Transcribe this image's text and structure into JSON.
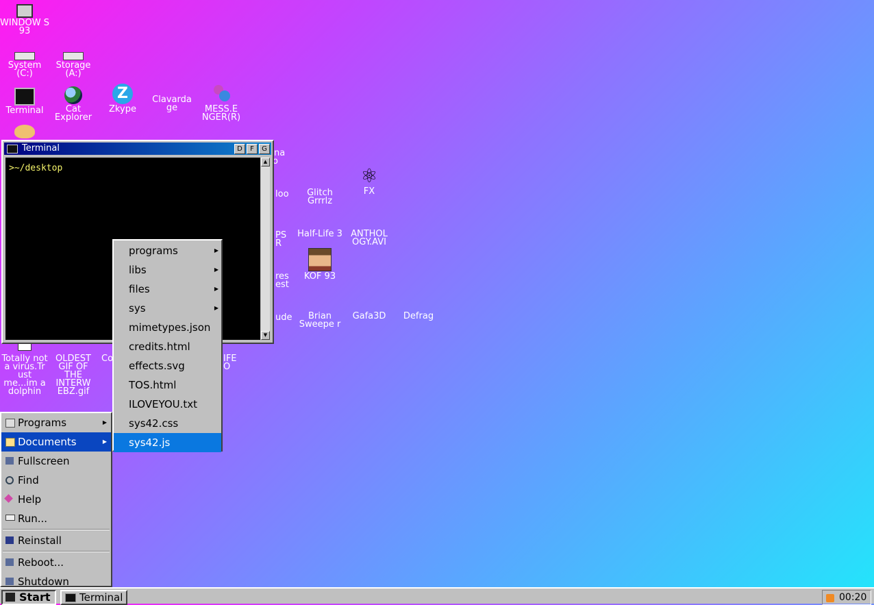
{
  "desktop": {
    "icons": [
      {
        "name": "windows93",
        "label": "WINDOW S 93",
        "glyph": "pc"
      },
      {
        "name": "system-c",
        "label": "System (C:)",
        "glyph": "drive"
      },
      {
        "name": "storage-a",
        "label": "Storage (A:)",
        "glyph": "drive"
      },
      {
        "name": "terminal",
        "label": "Terminal",
        "glyph": "terminal"
      },
      {
        "name": "cat-explorer",
        "label": "Cat Explorer",
        "glyph": "globe"
      },
      {
        "name": "zkype",
        "label": "Zkype",
        "glyph": "zk"
      },
      {
        "name": "clavardage",
        "label": "Clavarda ge",
        "glyph": "none"
      },
      {
        "name": "messenger",
        "label": "MESS.E NGER(R)",
        "glyph": "msn"
      },
      {
        "name": "glitch-grrrlz",
        "label": "Glitch Grrrlz",
        "glyph": "none"
      },
      {
        "name": "fx",
        "label": "FX",
        "glyph": "atom"
      },
      {
        "name": "half-life-3",
        "label": "Half-Life 3",
        "glyph": "none"
      },
      {
        "name": "anthology",
        "label": "ANTHOL OGY.AVI",
        "glyph": "none"
      },
      {
        "name": "kof-93",
        "label": "KOF 93",
        "glyph": "face"
      },
      {
        "name": "brian-sweeper",
        "label": "Brian Sweepe r",
        "glyph": "none"
      },
      {
        "name": "gafa3d",
        "label": "Gafa3D",
        "glyph": "none"
      },
      {
        "name": "defrag",
        "label": "Defrag",
        "glyph": "none"
      },
      {
        "name": "totally-not-a-virus",
        "label": "Totally not a virus.Tr ust me...im a dolphin",
        "glyph": "dolphin"
      },
      {
        "name": "oldest-gif",
        "label": "OLDEST GIF OF THE INTERW EBZ.gif",
        "glyph": "none"
      }
    ],
    "partial_labels": {
      "ana": "ana",
      "ana2": "o",
      "loo": "loo",
      "ps": "PS",
      "r": "R",
      "res": "res",
      "est": "est",
      "ude": "ude",
      "co": "Co",
      "ife": "IFE",
      "o": "O"
    }
  },
  "terminal_window": {
    "title": "Terminal",
    "buttons": [
      "D",
      "F",
      "G"
    ],
    "prompt": ">~/desktop"
  },
  "start_menu": {
    "items": [
      {
        "label": "Programs",
        "has_submenu": true,
        "icon": "programs-icon"
      },
      {
        "label": "Documents",
        "has_submenu": true,
        "icon": "documents-icon",
        "active": true
      },
      {
        "label": "Fullscreen",
        "has_submenu": false,
        "icon": "fullscreen-icon"
      },
      {
        "label": "Find",
        "has_submenu": false,
        "icon": "find-icon"
      },
      {
        "label": "Help",
        "has_submenu": false,
        "icon": "help-icon"
      },
      {
        "label": "Run...",
        "has_submenu": false,
        "icon": "run-icon"
      },
      {
        "label": "Reinstall",
        "has_submenu": false,
        "icon": "reinstall-icon"
      },
      {
        "label": "Reboot...",
        "has_submenu": false,
        "icon": "reboot-icon"
      },
      {
        "label": "Shutdown",
        "has_submenu": false,
        "icon": "shutdown-icon"
      }
    ]
  },
  "documents_submenu": {
    "items": [
      {
        "label": "programs",
        "has_submenu": true
      },
      {
        "label": "libs",
        "has_submenu": true
      },
      {
        "label": "files",
        "has_submenu": true
      },
      {
        "label": "sys",
        "has_submenu": true
      },
      {
        "label": "mimetypes.json",
        "has_submenu": false
      },
      {
        "label": "credits.html",
        "has_submenu": false
      },
      {
        "label": "effects.svg",
        "has_submenu": false
      },
      {
        "label": "TOS.html",
        "has_submenu": false
      },
      {
        "label": "ILOVEYOU.txt",
        "has_submenu": false
      },
      {
        "label": "sys42.css",
        "has_submenu": false
      },
      {
        "label": "sys42.js",
        "has_submenu": false,
        "active": true
      }
    ]
  },
  "taskbar": {
    "start_label": "Start",
    "tasks": [
      {
        "label": "Terminal"
      }
    ],
    "clock": "00:20"
  }
}
